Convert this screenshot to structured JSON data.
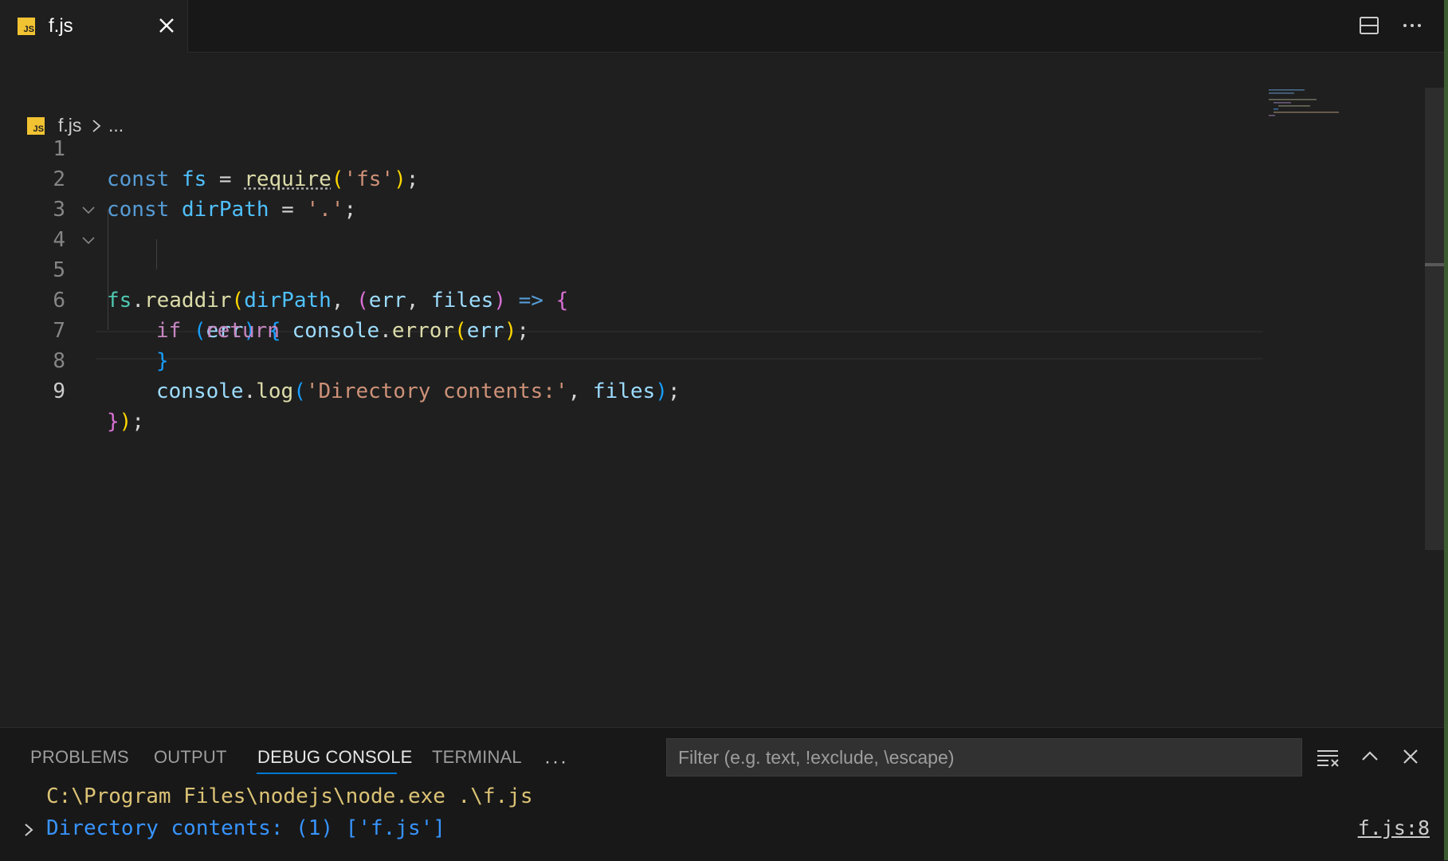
{
  "tab": {
    "label": "f.js",
    "icon_text": "JS"
  },
  "breadcrumb": {
    "file": "f.js",
    "ellipsis": "..."
  },
  "editor": {
    "lines": [
      {
        "num": "1"
      },
      {
        "num": "2"
      },
      {
        "num": "3"
      },
      {
        "num": "4"
      },
      {
        "num": "5"
      },
      {
        "num": "6"
      },
      {
        "num": "7"
      },
      {
        "num": "8"
      },
      {
        "num": "9"
      }
    ],
    "active_line": "9",
    "tokens": {
      "l1": [
        "const",
        "fs",
        "=",
        "require",
        "(",
        "'fs'",
        ")",
        ";"
      ],
      "l2": [
        "const",
        "dirPath",
        "=",
        "'.'",
        ";"
      ],
      "l4": [
        "fs",
        ".",
        "readdir",
        "(",
        "dirPath",
        ",",
        "(",
        "err",
        ",",
        "files",
        ")",
        "=>",
        "{"
      ],
      "l5": [
        "if",
        "(",
        "err",
        ")",
        "{"
      ],
      "l6": [
        "return",
        "console",
        ".",
        "error",
        "(",
        "err",
        ")",
        ";"
      ],
      "l7": [
        "}"
      ],
      "l8": [
        "console",
        ".",
        "log",
        "(",
        "'Directory contents:'",
        ",",
        "files",
        ")",
        ";"
      ],
      "l9": [
        "}",
        ")",
        ";"
      ]
    }
  },
  "panel": {
    "tabs": [
      "PROBLEMS",
      "OUTPUT",
      "DEBUG CONSOLE",
      "TERMINAL"
    ],
    "active_tab": "DEBUG CONSOLE",
    "more": "···",
    "filter_placeholder": "Filter (e.g. text, !exclude, \\escape)",
    "console_lines": [
      "C:\\Program Files\\nodejs\\node.exe .\\f.js",
      "Directory contents: (1) ['f.js']"
    ],
    "source_link": "f.js:8"
  },
  "colors": {
    "background": "#1f1f1f",
    "accent": "#0078d4",
    "js_badge": "#f1c232"
  },
  "icons": [
    "js-file-icon",
    "close-icon",
    "split-editor-icon",
    "more-actions-icon",
    "chevron-right-icon",
    "fold-chevron-icon",
    "clear-console-icon",
    "chevron-up-icon"
  ]
}
